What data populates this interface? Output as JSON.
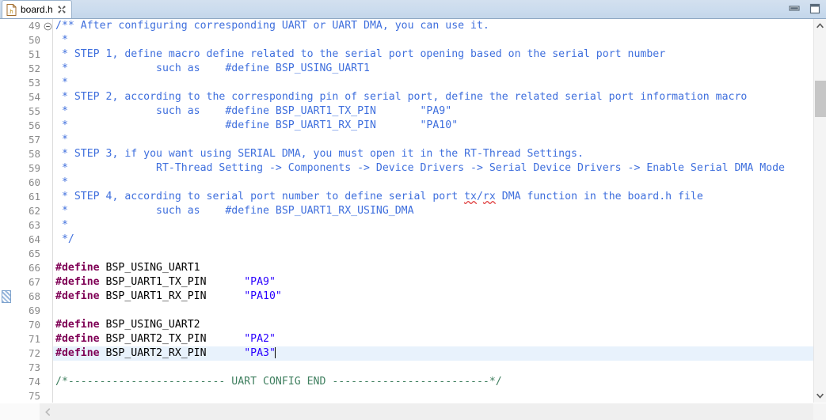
{
  "window": {
    "minimize_label": "Minimize",
    "maximize_label": "Maximize"
  },
  "tab": {
    "label": "board.h",
    "icon": "h-file-icon",
    "close_icon": "close-icon"
  },
  "editor": {
    "first_line_number": 49,
    "current_line_number": 72,
    "occurrence_marker_line": 68,
    "fold_marker_line": 49,
    "lines": [
      {
        "n": 49,
        "fold": "collapse",
        "tokens": [
          {
            "t": "comment",
            "s": "/** After configuring corresponding UART or UART DMA, you can use it."
          }
        ]
      },
      {
        "n": 50,
        "tokens": [
          {
            "t": "comment",
            "s": " *"
          }
        ]
      },
      {
        "n": 51,
        "tokens": [
          {
            "t": "comment",
            "s": " * STEP 1, define macro define related to the serial port opening based on the serial port number"
          }
        ]
      },
      {
        "n": 52,
        "tokens": [
          {
            "t": "comment",
            "s": " *              such as    #define BSP_USING_UART1"
          }
        ]
      },
      {
        "n": 53,
        "tokens": [
          {
            "t": "comment",
            "s": " *"
          }
        ]
      },
      {
        "n": 54,
        "tokens": [
          {
            "t": "comment",
            "s": " * STEP 2, according to the corresponding pin of serial port, define the related serial port information macro"
          }
        ]
      },
      {
        "n": 55,
        "tokens": [
          {
            "t": "comment",
            "s": " *              such as    #define BSP_UART1_TX_PIN       \"PA9\""
          }
        ]
      },
      {
        "n": 56,
        "tokens": [
          {
            "t": "comment",
            "s": " *                         #define BSP_UART1_RX_PIN       \"PA10\""
          }
        ]
      },
      {
        "n": 57,
        "tokens": [
          {
            "t": "comment",
            "s": " *"
          }
        ]
      },
      {
        "n": 58,
        "tokens": [
          {
            "t": "comment",
            "s": " * STEP 3, if you want using SERIAL DMA, you must open it in the RT-Thread Settings."
          }
        ]
      },
      {
        "n": 59,
        "tokens": [
          {
            "t": "comment",
            "s": " *              RT-Thread Setting -> Components -> Device Drivers -> Serial Device Drivers -> Enable Serial DMA Mode"
          }
        ]
      },
      {
        "n": 60,
        "tokens": [
          {
            "t": "comment",
            "s": " *"
          }
        ]
      },
      {
        "n": 61,
        "tokens": [
          {
            "t": "comment",
            "s": " * STEP 4, according to serial port number to define serial port "
          },
          {
            "t": "comment-spell",
            "s": "tx"
          },
          {
            "t": "comment",
            "s": "/"
          },
          {
            "t": "comment-spell",
            "s": "rx"
          },
          {
            "t": "comment",
            "s": " DMA function in the board.h file"
          }
        ]
      },
      {
        "n": 62,
        "tokens": [
          {
            "t": "comment",
            "s": " *              such as    #define BSP_UART1_RX_USING_DMA"
          }
        ]
      },
      {
        "n": 63,
        "tokens": [
          {
            "t": "comment",
            "s": " *"
          }
        ]
      },
      {
        "n": 64,
        "tokens": [
          {
            "t": "comment",
            "s": " */"
          }
        ]
      },
      {
        "n": 65,
        "tokens": []
      },
      {
        "n": 66,
        "tokens": [
          {
            "t": "pp",
            "s": "#define"
          },
          {
            "t": "ident",
            "s": " BSP_USING_UART1"
          }
        ]
      },
      {
        "n": 67,
        "tokens": [
          {
            "t": "pp",
            "s": "#define"
          },
          {
            "t": "ident",
            "s": " BSP_UART1_TX_PIN      "
          },
          {
            "t": "string",
            "s": "\"PA9\""
          }
        ]
      },
      {
        "n": 68,
        "tokens": [
          {
            "t": "pp",
            "s": "#define"
          },
          {
            "t": "ident",
            "s": " BSP_UART1_RX_PIN      "
          },
          {
            "t": "string",
            "s": "\"PA10\""
          }
        ]
      },
      {
        "n": 69,
        "tokens": []
      },
      {
        "n": 70,
        "tokens": [
          {
            "t": "pp",
            "s": "#define"
          },
          {
            "t": "ident",
            "s": " BSP_USING_UART2"
          }
        ]
      },
      {
        "n": 71,
        "tokens": [
          {
            "t": "pp",
            "s": "#define"
          },
          {
            "t": "ident",
            "s": " BSP_UART2_TX_PIN      "
          },
          {
            "t": "string",
            "s": "\"PA2\""
          }
        ]
      },
      {
        "n": 72,
        "current": true,
        "caret_after": true,
        "tokens": [
          {
            "t": "pp",
            "s": "#define"
          },
          {
            "t": "ident",
            "s": " BSP_UART2_RX_PIN      "
          },
          {
            "t": "string",
            "s": "\"PA3\""
          }
        ]
      },
      {
        "n": 73,
        "tokens": []
      },
      {
        "n": 74,
        "tokens": [
          {
            "t": "comment-green",
            "s": "/*------------------------- UART CONFIG END -------------------------*/"
          }
        ]
      },
      {
        "n": 75,
        "tokens": []
      }
    ]
  },
  "scrollbars": {
    "vertical": {
      "up_icon": "chevron-up-icon",
      "down_icon": "chevron-down-icon",
      "thumb_top_pct": 13,
      "thumb_height_pct": 10
    },
    "horizontal": {
      "left_icon": "chevron-left-icon"
    }
  },
  "colors": {
    "comment_blue": "#3f6fdd",
    "comment_green": "#3f7f5f",
    "preprocessor": "#7f0055",
    "string": "#2a00ff",
    "current_line_bg": "#e8f2fc",
    "tabbar_bg": "#cbdcee",
    "gutter_fg": "#8a8a8a"
  }
}
